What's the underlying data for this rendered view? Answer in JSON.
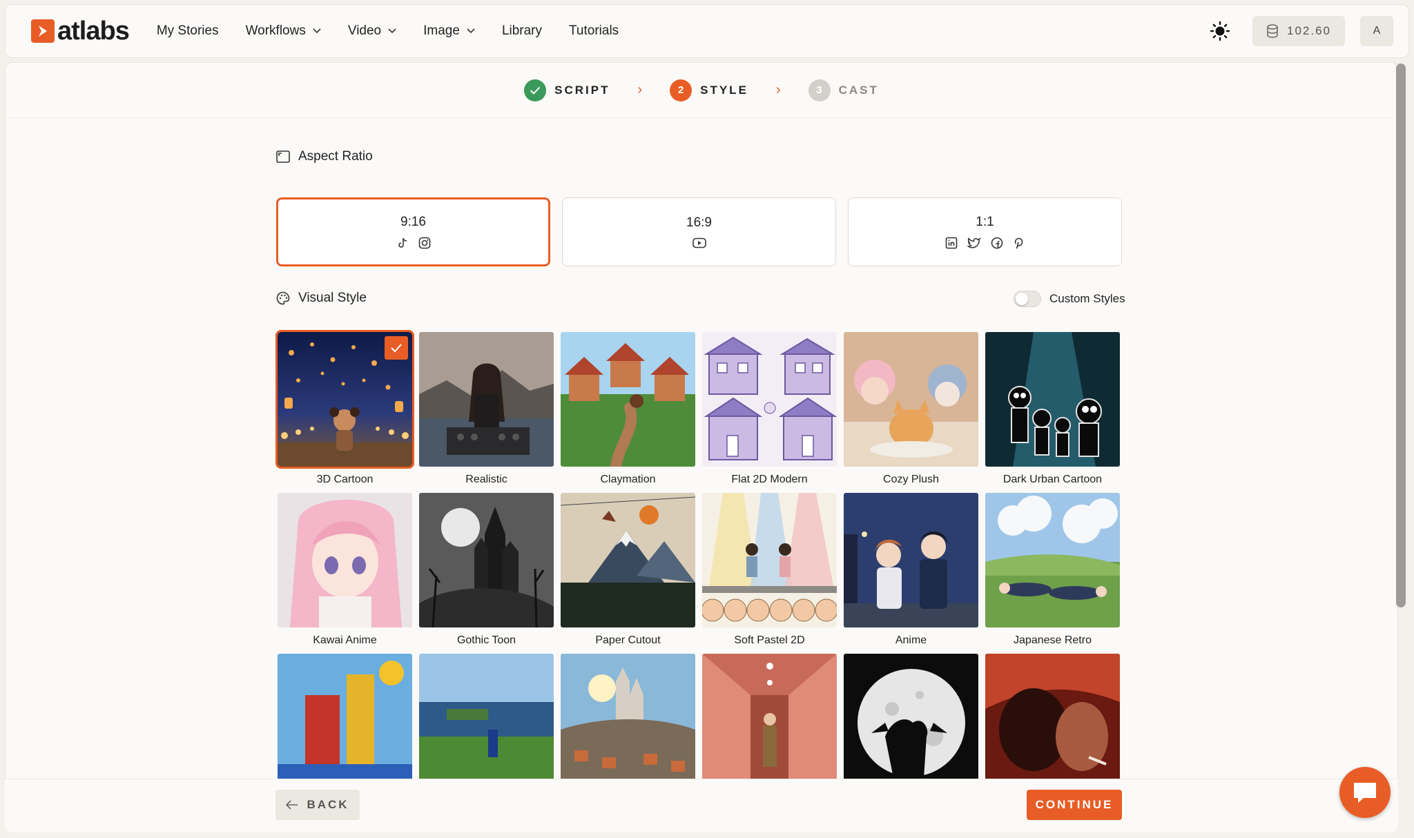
{
  "brand": {
    "name": "atlabs",
    "accent": "#e85d26"
  },
  "nav": {
    "items": [
      {
        "label": "My Stories",
        "dropdown": false
      },
      {
        "label": "Workflows",
        "dropdown": true
      },
      {
        "label": "Video",
        "dropdown": true
      },
      {
        "label": "Image",
        "dropdown": true
      },
      {
        "label": "Library",
        "dropdown": false
      },
      {
        "label": "Tutorials",
        "dropdown": false
      }
    ]
  },
  "header": {
    "credits": "102.60",
    "avatar_initial": "A",
    "theme_icon": "sun-icon"
  },
  "steps": [
    {
      "label": "SCRIPT",
      "state": "done",
      "number": ""
    },
    {
      "label": "STYLE",
      "state": "active",
      "number": "2"
    },
    {
      "label": "CAST",
      "state": "pending",
      "number": "3"
    }
  ],
  "aspect_ratio": {
    "title": "Aspect Ratio",
    "options": [
      {
        "label": "9:16",
        "icons": [
          "tiktok-icon",
          "instagram-icon"
        ],
        "selected": true
      },
      {
        "label": "16:9",
        "icons": [
          "youtube-icon"
        ],
        "selected": false
      },
      {
        "label": "1:1",
        "icons": [
          "linkedin-icon",
          "twitter-icon",
          "facebook-icon",
          "pinterest-icon"
        ],
        "selected": false
      }
    ]
  },
  "visual_style": {
    "title": "Visual Style",
    "custom_styles_label": "Custom Styles",
    "custom_styles_on": false,
    "styles": [
      {
        "label": "3D Cartoon",
        "selected": true
      },
      {
        "label": "Realistic",
        "selected": false
      },
      {
        "label": "Claymation",
        "selected": false
      },
      {
        "label": "Flat 2D Modern",
        "selected": false
      },
      {
        "label": "Cozy Plush",
        "selected": false
      },
      {
        "label": "Dark Urban Cartoon",
        "selected": false
      },
      {
        "label": "Kawai Anime",
        "selected": false
      },
      {
        "label": "Gothic Toon",
        "selected": false
      },
      {
        "label": "Paper Cutout",
        "selected": false
      },
      {
        "label": "Soft Pastel 2D",
        "selected": false
      },
      {
        "label": "Anime",
        "selected": false
      },
      {
        "label": "Japanese Retro",
        "selected": false
      },
      {
        "label": "",
        "selected": false
      },
      {
        "label": "",
        "selected": false
      },
      {
        "label": "",
        "selected": false
      },
      {
        "label": "",
        "selected": false
      },
      {
        "label": "",
        "selected": false
      },
      {
        "label": "",
        "selected": false
      }
    ]
  },
  "footer": {
    "back_label": "BACK",
    "continue_label": "CONTINUE"
  }
}
